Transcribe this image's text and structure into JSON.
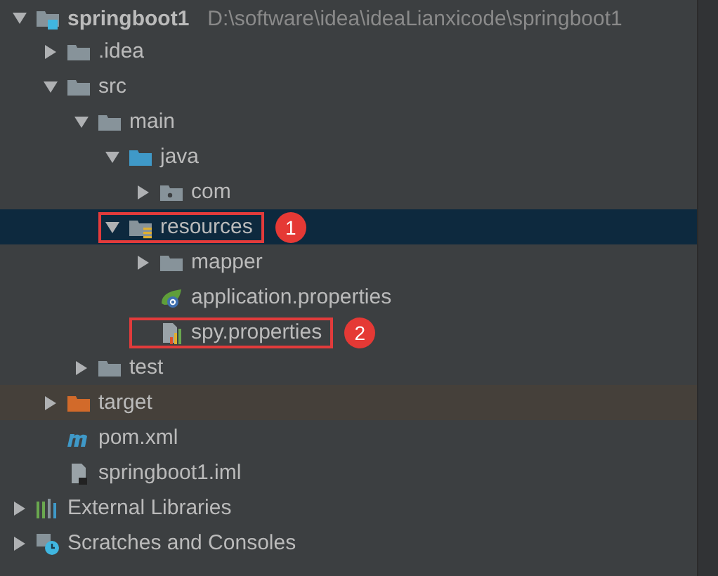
{
  "tree": [
    {
      "label": "springboot1",
      "path": "D:\\software\\idea\\ideaLianxicode\\springboot1",
      "kind": "module",
      "expanded": true,
      "selected": false,
      "children": [
        {
          "label": ".idea",
          "kind": "folder",
          "expanded": false,
          "selected": false
        },
        {
          "label": "src",
          "kind": "folder",
          "expanded": true,
          "selected": false,
          "children": [
            {
              "label": "main",
              "kind": "folder",
              "expanded": true,
              "selected": false,
              "children": [
                {
                  "label": "java",
                  "kind": "source-folder",
                  "expanded": true,
                  "selected": false,
                  "children": [
                    {
                      "label": "com",
                      "kind": "package",
                      "expanded": false,
                      "selected": false
                    }
                  ]
                },
                {
                  "label": "resources",
                  "kind": "resources-folder",
                  "expanded": true,
                  "selected": true,
                  "callout": "1",
                  "children": [
                    {
                      "label": "mapper",
                      "kind": "folder",
                      "expanded": false,
                      "selected": false
                    },
                    {
                      "label": "application.properties",
                      "kind": "spring-file",
                      "selected": false
                    },
                    {
                      "label": "spy.properties",
                      "kind": "properties-file",
                      "selected": false,
                      "callout": "2"
                    }
                  ]
                }
              ]
            },
            {
              "label": "test",
              "kind": "folder",
              "expanded": false,
              "selected": false
            }
          ]
        },
        {
          "label": "target",
          "kind": "excluded-folder",
          "expanded": false,
          "selected": false
        },
        {
          "label": "pom.xml",
          "kind": "maven-file",
          "selected": false
        },
        {
          "label": "springboot1.iml",
          "kind": "iml-file",
          "selected": false
        }
      ]
    },
    {
      "label": "External Libraries",
      "kind": "libraries",
      "expanded": false,
      "selected": false
    },
    {
      "label": "Scratches and Consoles",
      "kind": "scratches",
      "expanded": false,
      "selected": false
    }
  ]
}
